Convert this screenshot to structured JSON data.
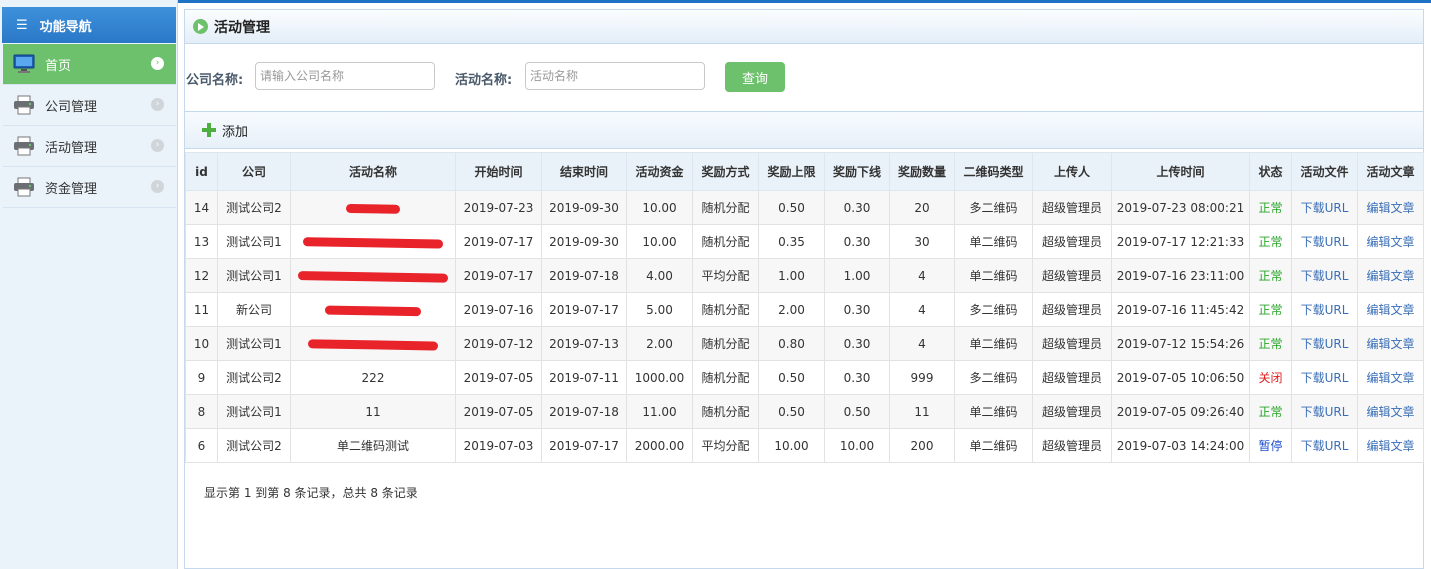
{
  "sidebar": {
    "title": "功能导航",
    "items": [
      {
        "label": "首页",
        "active": true
      },
      {
        "label": "公司管理",
        "active": false
      },
      {
        "label": "活动管理",
        "active": false
      },
      {
        "label": "资金管理",
        "active": false
      }
    ]
  },
  "panel": {
    "title": "活动管理",
    "search": {
      "company_label": "公司名称:",
      "company_placeholder": "请输入公司名称",
      "activity_label": "活动名称:",
      "activity_placeholder": "活动名称",
      "query_button": "查询"
    },
    "toolbar": {
      "add_label": "添加"
    },
    "table": {
      "headers": [
        "id",
        "公司",
        "活动名称",
        "开始时间",
        "结束时间",
        "活动资金",
        "奖励方式",
        "奖励上限",
        "奖励下线",
        "奖励数量",
        "二维码类型",
        "上传人",
        "上传时间",
        "状态",
        "活动文件",
        "活动文章"
      ],
      "rows": [
        {
          "id": "14",
          "company": "测试公司2",
          "name": "",
          "redacted": true,
          "start": "2019-07-23",
          "end": "2019-09-30",
          "funds": "10.00",
          "reward_mode": "随机分配",
          "upper": "0.50",
          "lower": "0.30",
          "count": "20",
          "qr_type": "多二维码",
          "uploader": "超级管理员",
          "upload_time": "2019-07-23 08:00:21",
          "status": "正常",
          "status_kind": "ok",
          "file_link": "下载URL",
          "article_link": "编辑文章"
        },
        {
          "id": "13",
          "company": "测试公司1",
          "name": "",
          "redacted": true,
          "start": "2019-07-17",
          "end": "2019-09-30",
          "funds": "10.00",
          "reward_mode": "随机分配",
          "upper": "0.35",
          "lower": "0.30",
          "count": "30",
          "qr_type": "单二维码",
          "uploader": "超级管理员",
          "upload_time": "2019-07-17 12:21:33",
          "status": "正常",
          "status_kind": "ok",
          "file_link": "下载URL",
          "article_link": "编辑文章"
        },
        {
          "id": "12",
          "company": "测试公司1",
          "name": "",
          "redacted": true,
          "start": "2019-07-17",
          "end": "2019-07-18",
          "funds": "4.00",
          "reward_mode": "平均分配",
          "upper": "1.00",
          "lower": "1.00",
          "count": "4",
          "qr_type": "单二维码",
          "uploader": "超级管理员",
          "upload_time": "2019-07-16 23:11:00",
          "status": "正常",
          "status_kind": "ok",
          "file_link": "下载URL",
          "article_link": "编辑文章"
        },
        {
          "id": "11",
          "company": "新公司",
          "name": "",
          "redacted": true,
          "start": "2019-07-16",
          "end": "2019-07-17",
          "funds": "5.00",
          "reward_mode": "随机分配",
          "upper": "2.00",
          "lower": "0.30",
          "count": "4",
          "qr_type": "多二维码",
          "uploader": "超级管理员",
          "upload_time": "2019-07-16 11:45:42",
          "status": "正常",
          "status_kind": "ok",
          "file_link": "下载URL",
          "article_link": "编辑文章"
        },
        {
          "id": "10",
          "company": "测试公司1",
          "name": "",
          "redacted": true,
          "start": "2019-07-12",
          "end": "2019-07-13",
          "funds": "2.00",
          "reward_mode": "随机分配",
          "upper": "0.80",
          "lower": "0.30",
          "count": "4",
          "qr_type": "单二维码",
          "uploader": "超级管理员",
          "upload_time": "2019-07-12 15:54:26",
          "status": "正常",
          "status_kind": "ok",
          "file_link": "下载URL",
          "article_link": "编辑文章"
        },
        {
          "id": "9",
          "company": "测试公司2",
          "name": "222",
          "redacted": false,
          "start": "2019-07-05",
          "end": "2019-07-11",
          "funds": "1000.00",
          "reward_mode": "随机分配",
          "upper": "0.50",
          "lower": "0.30",
          "count": "999",
          "qr_type": "多二维码",
          "uploader": "超级管理员",
          "upload_time": "2019-07-05 10:06:50",
          "status": "关闭",
          "status_kind": "close",
          "file_link": "下载URL",
          "article_link": "编辑文章"
        },
        {
          "id": "8",
          "company": "测试公司1",
          "name": "11",
          "redacted": false,
          "start": "2019-07-05",
          "end": "2019-07-18",
          "funds": "11.00",
          "reward_mode": "随机分配",
          "upper": "0.50",
          "lower": "0.50",
          "count": "11",
          "qr_type": "单二维码",
          "uploader": "超级管理员",
          "upload_time": "2019-07-05 09:26:40",
          "status": "正常",
          "status_kind": "ok",
          "file_link": "下载URL",
          "article_link": "编辑文章"
        },
        {
          "id": "6",
          "company": "测试公司2",
          "name": "单二维码测试",
          "redacted": false,
          "start": "2019-07-03",
          "end": "2019-07-17",
          "funds": "2000.00",
          "reward_mode": "平均分配",
          "upper": "10.00",
          "lower": "10.00",
          "count": "200",
          "qr_type": "单二维码",
          "uploader": "超级管理员",
          "upload_time": "2019-07-03 14:24:00",
          "status": "暂停",
          "status_kind": "pause",
          "file_link": "下载URL",
          "article_link": "编辑文章"
        }
      ]
    },
    "footer": "显示第 1 到第 8 条记录，总共 8 条记录"
  },
  "colors": {
    "accent_green": "#6dc06c",
    "sidebar_header_blue": "#2a78c8",
    "status_ok": "#2aa52a",
    "status_close": "#e02020",
    "status_pause": "#1f4fd0",
    "link_blue": "#3a6fb7",
    "redaction_red": "#e8232a"
  },
  "icons": {
    "sidebar_header": "list-icon",
    "home": "monitor-icon",
    "menu": "printer-icon",
    "panel_title": "play-circle-icon",
    "add": "plus-icon",
    "chevron": "chevron-right-circle-icon"
  }
}
